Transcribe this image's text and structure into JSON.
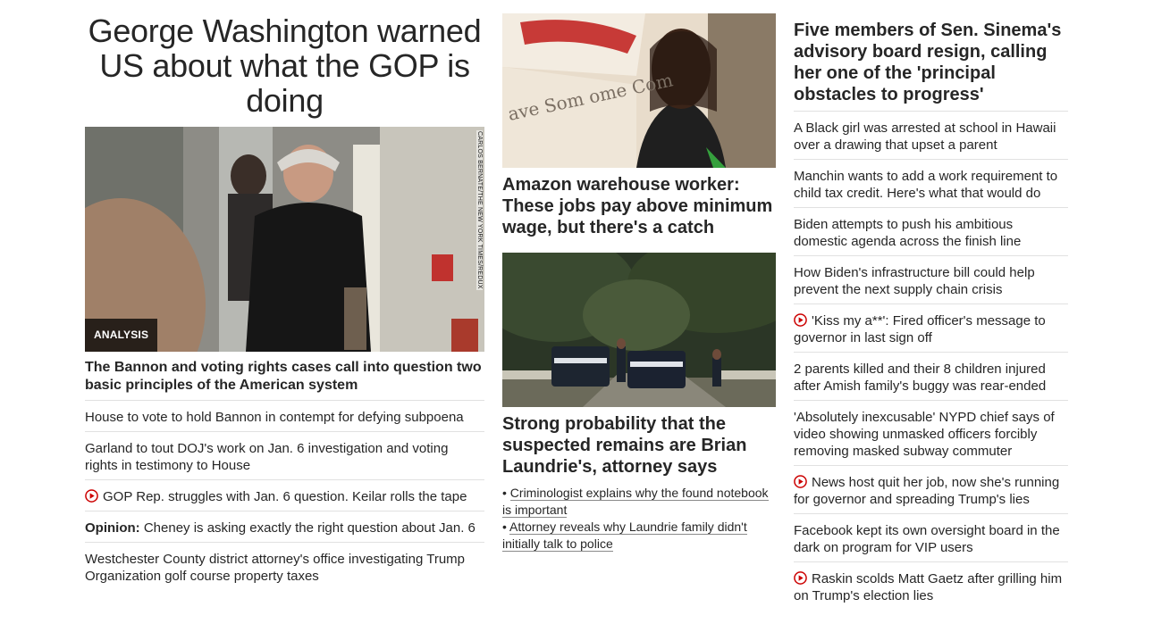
{
  "left": {
    "headline": "George Washington warned US about what the GOP is doing",
    "image_credit": "CARLOS BERNATE/THE NEW YORK TIMES/REDUX",
    "badge": "ANALYSIS",
    "bold_story": "The Bannon and voting rights cases call into question two basic principles of the American system",
    "stories": [
      {
        "text": "House to vote to hold Bannon in contempt for defying subpoena"
      },
      {
        "text": "Garland to tout DOJ's work on Jan. 6 investigation and voting rights in testimony to House"
      },
      {
        "text": "GOP Rep. struggles with Jan. 6 question. Keilar rolls the tape",
        "icon": "play-icon"
      },
      {
        "label": "Opinion:",
        "text": "Cheney is asking exactly the right question about Jan. 6"
      },
      {
        "text": "Westchester County district attorney's office investigating Trump Organization golf course property taxes"
      }
    ]
  },
  "middle": {
    "story1": {
      "headline": "Amazon warehouse worker: These jobs pay above minimum wage, but there's a catch",
      "image_sign_text": "ave Som  ome Com"
    },
    "story2": {
      "headline": "Strong probability that the suspected remains are Brian Laundrie's, attorney says",
      "sub_links": [
        "Criminologist explains why the found notebook is important",
        "Attorney reveals why Laundrie family didn't initially talk to police"
      ]
    }
  },
  "right": {
    "headline": "Five members of Sen. Sinema's advisory board resign, calling her one of the 'principal obstacles to progress'",
    "stories": [
      {
        "text": "A Black girl was arrested at school in Hawaii over a drawing that upset a parent"
      },
      {
        "text": "Manchin wants to add a work requirement to child tax credit. Here's what that would do"
      },
      {
        "text": "Biden attempts to push his ambitious domestic agenda across the finish line"
      },
      {
        "text": "How Biden's infrastructure bill could help prevent the next supply chain crisis"
      },
      {
        "text": "'Kiss my a**': Fired officer's message to governor in last sign off",
        "icon": "play-icon"
      },
      {
        "text": "2 parents killed and their 8 children injured after Amish family's buggy was rear-ended"
      },
      {
        "text": "'Absolutely inexcusable' NYPD chief says of video showing unmasked officers forcibly removing masked subway commuter"
      },
      {
        "text": "News host quit her job, now she's running for governor and spreading Trump's lies",
        "icon": "play-icon"
      },
      {
        "text": "Facebook kept its own oversight board in the dark on program for VIP users"
      },
      {
        "text": "Raskin scolds Matt Gaetz after grilling him on Trump's election lies",
        "icon": "play-icon"
      }
    ]
  },
  "colors": {
    "text": "#262626",
    "divider": "#e1e1e1",
    "video_icon": "#cc0000",
    "badge_bg": "#000000"
  }
}
